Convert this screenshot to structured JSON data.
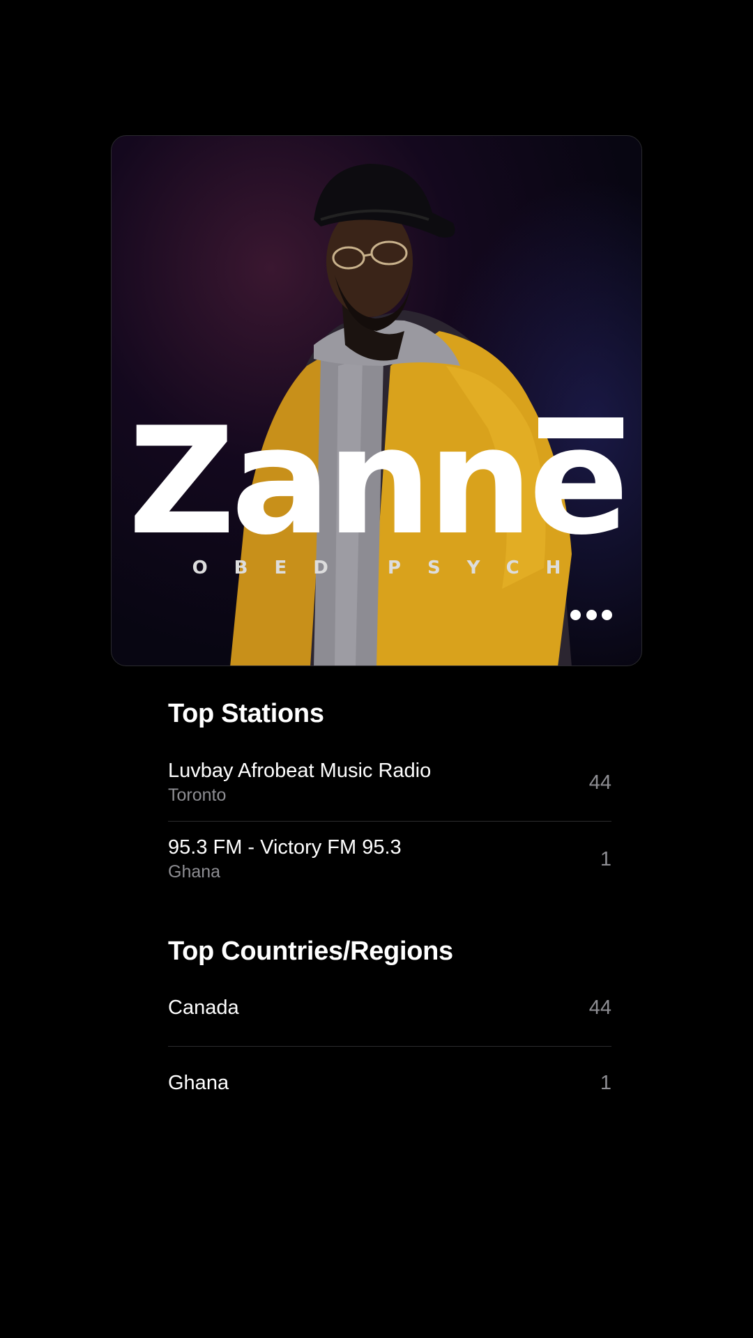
{
  "artwork": {
    "title": "Zanne",
    "subtitle": "OBED PSYCH",
    "more_icon": "ellipsis-icon"
  },
  "top_stations": {
    "title": "Top Stations",
    "items": [
      {
        "name": "Luvbay Afrobeat Music Radio",
        "location": "Toronto",
        "count": "44"
      },
      {
        "name": "95.3 FM - Victory FM 95.3",
        "location": "Ghana",
        "count": "1"
      }
    ]
  },
  "top_countries": {
    "title": "Top Countries/Regions",
    "items": [
      {
        "name": "Canada",
        "count": "44"
      },
      {
        "name": "Ghana",
        "count": "1"
      }
    ]
  },
  "colors": {
    "background": "#000000",
    "primary_text": "#ffffff",
    "secondary_text": "#8e8e93",
    "divider": "#2c2c2e",
    "jacket": "#d9a21c"
  }
}
